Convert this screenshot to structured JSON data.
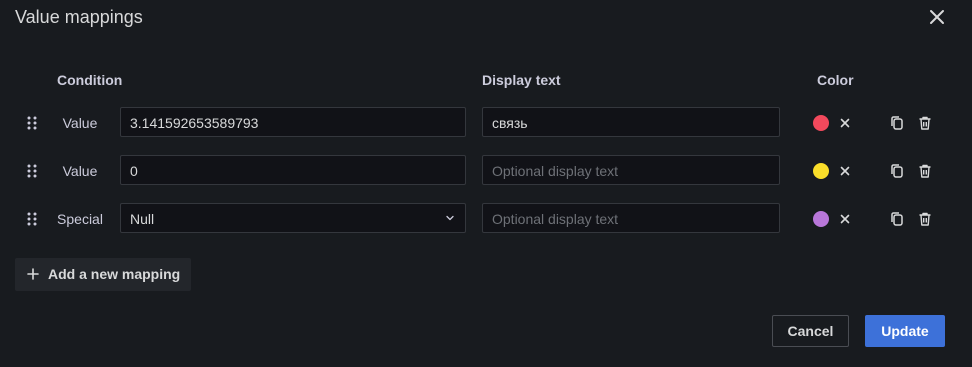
{
  "dialog": {
    "title": "Value mappings",
    "close_icon": "close-icon"
  },
  "columns": {
    "condition": "Condition",
    "display_text": "Display text",
    "color": "Color"
  },
  "mappings": [
    {
      "type": "Value",
      "condition_value": "3.141592653589793",
      "display_text": "связь",
      "display_placeholder": "Optional display text",
      "color": "#f2495c"
    },
    {
      "type": "Value",
      "condition_value": "0",
      "display_text": "",
      "display_placeholder": "Optional display text",
      "color": "#fade2a"
    },
    {
      "type": "Special",
      "condition_value": "Null",
      "display_text": "",
      "display_placeholder": "Optional display text",
      "color": "#b877d9"
    }
  ],
  "add_mapping_label": "Add a new mapping",
  "footer": {
    "cancel_label": "Cancel",
    "update_label": "Update",
    "update_color": "#3d71d9"
  }
}
